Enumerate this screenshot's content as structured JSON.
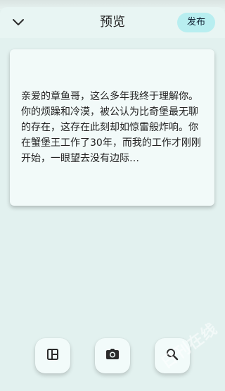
{
  "header": {
    "title": "预览",
    "publish_label": "发布",
    "back_icon": "chevron-down-icon"
  },
  "preview": {
    "text": "亲爱的章鱼哥，这么多年我终于理解你。你的烦躁和冷漠，被公认为比奇堡最无聊的存在，这存在此刻却如惊雷般炸响。你在蟹堡王工作了30年，而我的工作才刚刚开始，一眼望去没有边际…"
  },
  "toolbar": {
    "items": [
      {
        "icon": "layout-icon"
      },
      {
        "icon": "camera-icon"
      },
      {
        "icon": "search-icon"
      }
    ]
  },
  "watermark": {
    "text": "日刊在线"
  },
  "colors": {
    "background": "#e2f1ef",
    "header": "#e8f5f3",
    "card": "#f2faf9",
    "publish_button": "#b8eef0",
    "icon": "#2b2b2b"
  }
}
